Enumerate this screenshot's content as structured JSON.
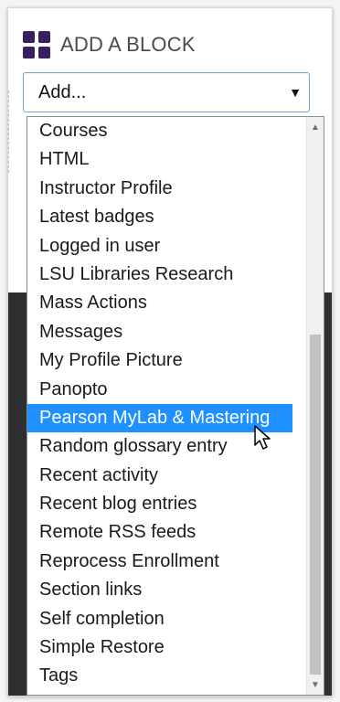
{
  "block": {
    "title": "ADD A BLOCK",
    "icon": "grid-icon",
    "accent": "#3a1f5c"
  },
  "select": {
    "value": "Add...",
    "arrow_icon": "caret-down-icon"
  },
  "dropdown": {
    "selected_index": 9,
    "selected_color": "#1e90ff",
    "options": [
      "Courses",
      "HTML",
      "Instructor Profile",
      "Latest badges",
      "Logged in user",
      "LSU Libraries Research",
      "Mass Actions",
      "Messages",
      "My Profile Picture",
      "Panopto",
      "Pearson MyLab & Mastering",
      "Random glossary entry",
      "Recent activity",
      "Recent blog entries",
      "Remote RSS feeds",
      "Reprocess Enrollment",
      "Section links",
      "Self completion",
      "Simple Restore",
      "Tags"
    ]
  },
  "scrollbar": {
    "up_icon": "scroll-up-icon",
    "down_icon": "scroll-down-icon"
  },
  "cursor": {
    "icon": "mouse-pointer-icon"
  }
}
